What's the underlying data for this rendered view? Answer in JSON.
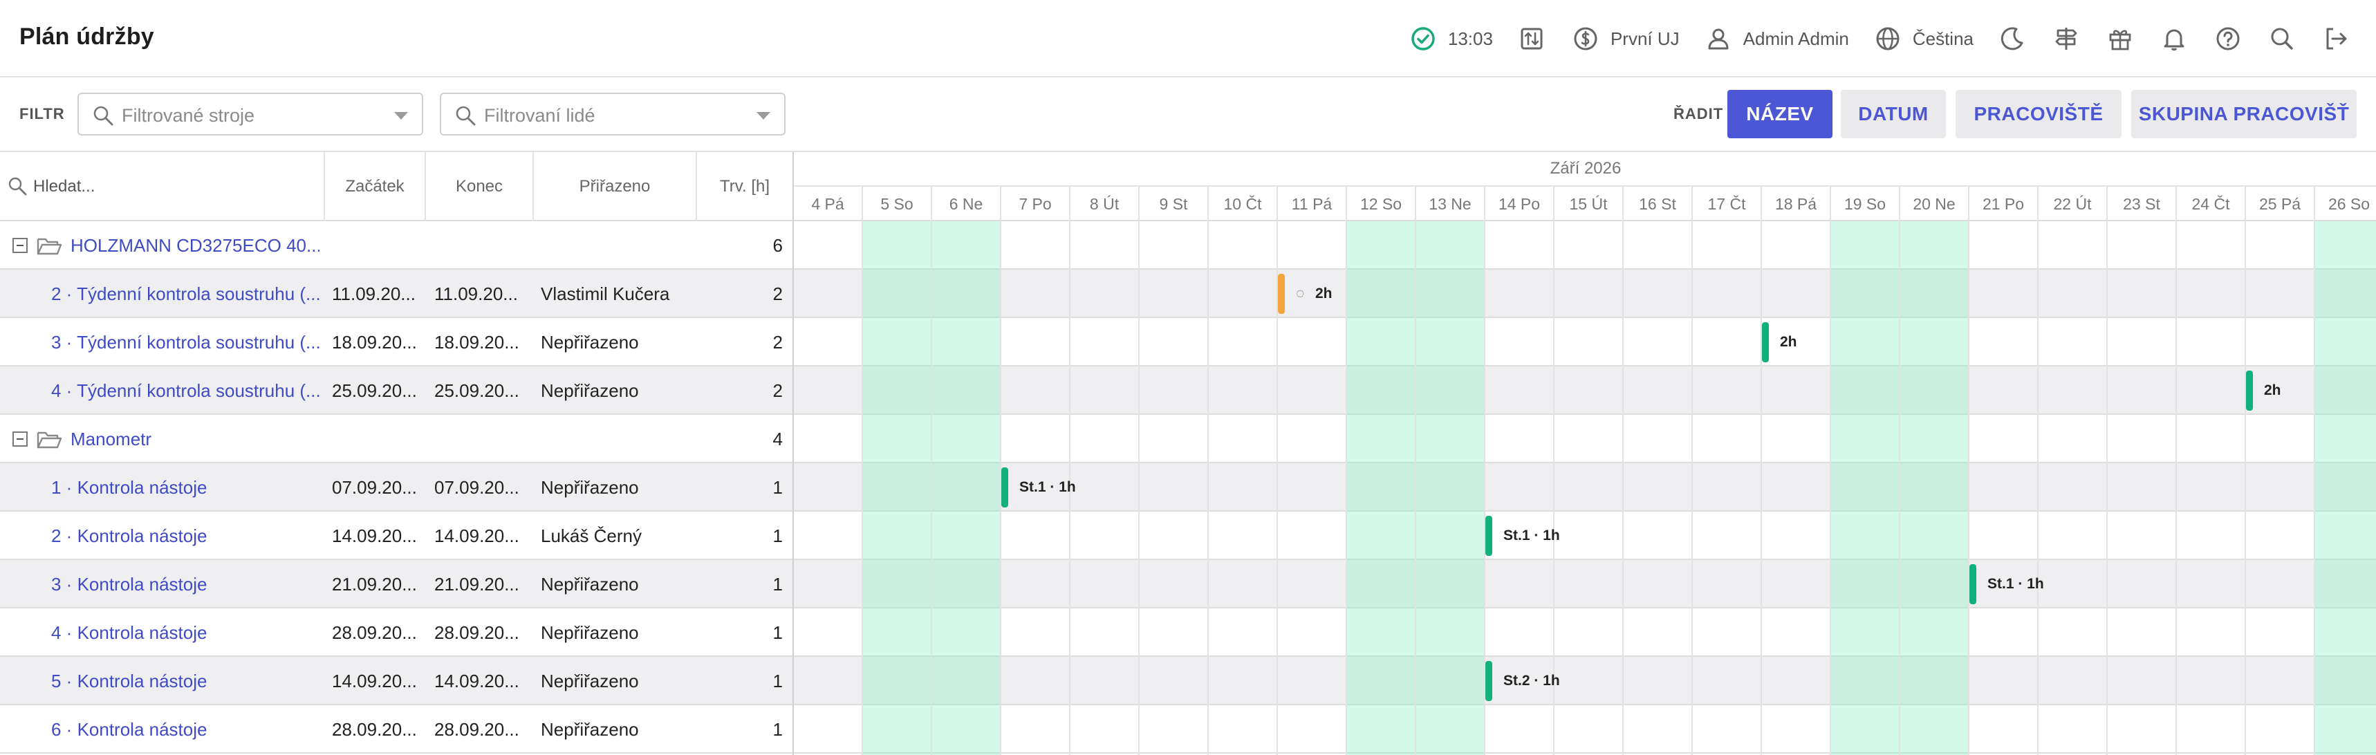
{
  "header": {
    "title": "Plán údržby",
    "time": "13:03",
    "unit": "První UJ",
    "user": "Admin Admin",
    "language": "Čeština",
    "status_color": "#1aab77"
  },
  "filter": {
    "label": "FILTR",
    "machines_placeholder": "Filtrované stroje",
    "people_placeholder": "Filtrovaní lidé"
  },
  "sort": {
    "label": "ŘADIT DLE",
    "options": [
      "NÁZEV",
      "DATUM",
      "PRACOVIŠTĚ",
      "SKUPINA PRACOVIŠŤ"
    ],
    "active_index": 0,
    "accent": "#4b57d4"
  },
  "columns": {
    "search_placeholder": "Hledat...",
    "start": "Začátek",
    "end": "Konec",
    "assigned": "Přiřazeno",
    "duration": "Trv. [h]"
  },
  "timeline": {
    "month": "Září 2026",
    "days": [
      "4 Pá",
      "5 So",
      "6 Ne",
      "7 Po",
      "8 Út",
      "9 St",
      "10 Čt",
      "11 Pá",
      "12 So",
      "13 Ne",
      "14 Po",
      "15 Út",
      "16 St",
      "17 Čt",
      "18 Pá",
      "19 So",
      "20 Ne",
      "21 Po",
      "22 Út",
      "23 St",
      "24 Čt",
      "25 Pá",
      "26 So"
    ],
    "weekend_indices": [
      1,
      2,
      8,
      9,
      15,
      16,
      22
    ],
    "weekend_color": "#cff6e6"
  },
  "rows": [
    {
      "type": "group",
      "name": "HOLZMANN CD3275ECO 40...",
      "duration": "6"
    },
    {
      "type": "task",
      "name": "2 · Týdenní kontrola soustruhu (...",
      "start": "11.09.20...",
      "end": "11.09.20...",
      "assignee": "Vlastimil Kučera",
      "duration": "2",
      "day_index": 7,
      "bar_label": "2h",
      "in_progress": true,
      "bar_color": "#f3a43a"
    },
    {
      "type": "task",
      "name": "3 · Týdenní kontrola soustruhu (...",
      "start": "18.09.20...",
      "end": "18.09.20...",
      "assignee": "Nepřiřazeno",
      "duration": "2",
      "day_index": 14,
      "bar_label": "2h",
      "bar_color": "#12b07c"
    },
    {
      "type": "task",
      "name": "4 · Týdenní kontrola soustruhu (...",
      "start": "25.09.20...",
      "end": "25.09.20...",
      "assignee": "Nepřiřazeno",
      "duration": "2",
      "day_index": 21,
      "bar_label": "2h",
      "bar_color": "#12b07c"
    },
    {
      "type": "group",
      "name": "Manometr",
      "duration": "4"
    },
    {
      "type": "task",
      "name": "1 · Kontrola nástoje",
      "start": "07.09.20...",
      "end": "07.09.20...",
      "assignee": "Nepřiřazeno",
      "duration": "1",
      "day_index": 3,
      "bar_label": "St.1 · 1h",
      "bar_color": "#12b07c"
    },
    {
      "type": "task",
      "name": "2 · Kontrola nástoje",
      "start": "14.09.20...",
      "end": "14.09.20...",
      "assignee": "Lukáš Černý",
      "duration": "1",
      "day_index": 10,
      "bar_label": "St.1 · 1h",
      "bar_color": "#12b07c"
    },
    {
      "type": "task",
      "name": "3 · Kontrola nástoje",
      "start": "21.09.20...",
      "end": "21.09.20...",
      "assignee": "Nepřiřazeno",
      "duration": "1",
      "day_index": 17,
      "bar_label": "St.1 · 1h",
      "bar_color": "#12b07c"
    },
    {
      "type": "task",
      "name": "4 · Kontrola nástoje",
      "start": "28.09.20...",
      "end": "28.09.20...",
      "assignee": "Nepřiřazeno",
      "duration": "1"
    },
    {
      "type": "task",
      "name": "5 · Kontrola nástoje",
      "start": "14.09.20...",
      "end": "14.09.20...",
      "assignee": "Nepřiřazeno",
      "duration": "1",
      "day_index": 10,
      "bar_label": "St.2 · 1h",
      "bar_color": "#12b07c"
    },
    {
      "type": "task",
      "name": "6 · Kontrola nástoje",
      "start": "28.09.20...",
      "end": "28.09.20...",
      "assignee": "Nepřiřazeno",
      "duration": "1"
    }
  ]
}
